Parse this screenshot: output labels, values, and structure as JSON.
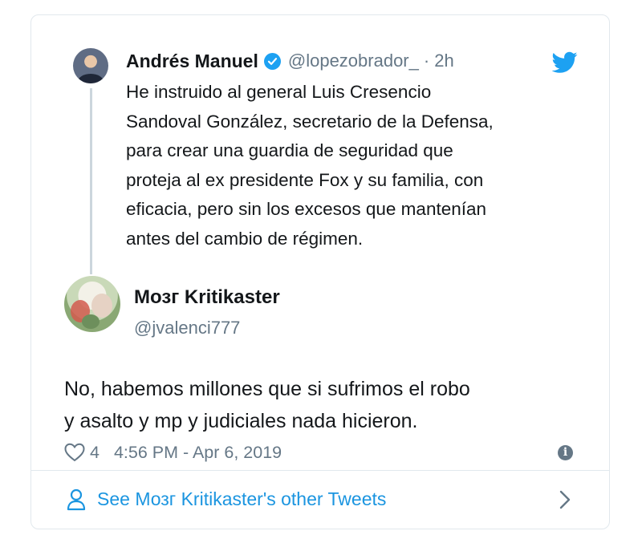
{
  "quoted_tweet": {
    "author_name": "Andrés Manuel",
    "author_handle": "@lopezobrador_",
    "separator": "·",
    "time_ago": "2h",
    "text": "He instruido al general Luis Cresencio\nSandoval González, secretario de la Defensa,\npara crear una guardia de seguridad que\nproteja al ex presidente Fox y su familia, con\neficacia, pero sin los excesos que mantenían\nantes del cambio de régimen.",
    "icons": {
      "verified": "verified-badge-icon",
      "brand": "twitter-bird-icon"
    }
  },
  "reply_tweet": {
    "author_name": "Мозг Kritikaster",
    "author_handle": "@jvalenci777",
    "text": "No, habemos millones que si sufrimos el robo\ny asalto y mp y judiciales nada hicieron.",
    "like_count": "4",
    "timestamp": "4:56 PM - Apr 6, 2019",
    "icons": {
      "like": "heart-icon",
      "info": "info-icon"
    }
  },
  "footer": {
    "link_text": "See Мозг Kritikaster's other Tweets",
    "icons": {
      "person": "person-icon",
      "chevron": "chevron-right-icon"
    }
  },
  "colors": {
    "text": "#14171a",
    "secondary": "#657786",
    "accent": "#1da1f2",
    "link": "#1b95e0",
    "border": "#e1e8ed"
  }
}
